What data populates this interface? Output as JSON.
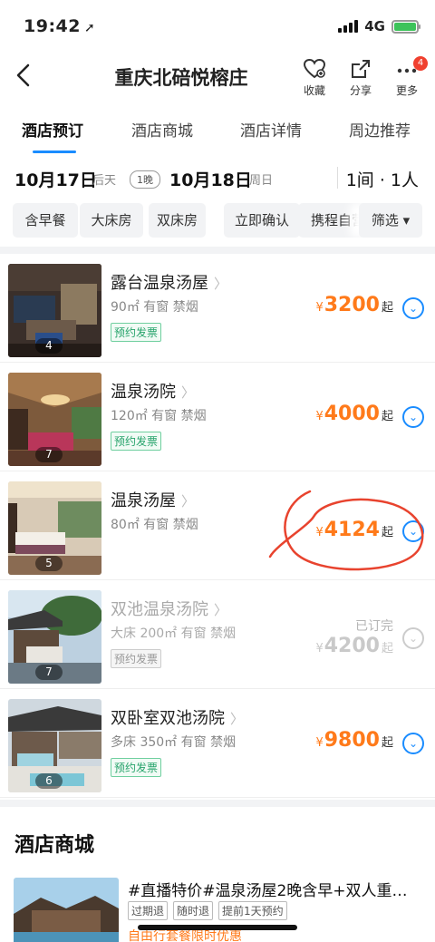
{
  "status": {
    "time": "19:42",
    "network": "4G"
  },
  "nav": {
    "title": "重庆北碚悦榕庄",
    "actions": [
      {
        "label": "收藏",
        "icon": "heart-icon"
      },
      {
        "label": "分享",
        "icon": "share-icon"
      },
      {
        "label": "更多",
        "icon": "more-icon",
        "badge": "4"
      }
    ]
  },
  "tabs": [
    "酒店预订",
    "酒店商城",
    "酒店详情",
    "周边推荐"
  ],
  "dates": {
    "checkin": "10月17日",
    "checkin_day": "后天",
    "nights": "1晚",
    "checkout": "10月18日",
    "checkout_day": "周日",
    "rooms_guests": "1间 · 1人"
  },
  "filters": [
    "含早餐",
    "大床房",
    "双床房",
    "立即确认",
    "携程自营"
  ],
  "filter_button": "筛选 ▾",
  "rooms": [
    {
      "name": "露台温泉汤屋",
      "info": "90㎡  有窗  禁烟",
      "invoice": "预约发票",
      "price": "3200",
      "photos": "4",
      "sold_out": false
    },
    {
      "name": "温泉汤院",
      "info": "120㎡  有窗  禁烟",
      "invoice": "预约发票",
      "price": "4000",
      "photos": "7",
      "sold_out": false
    },
    {
      "name": "温泉汤屋",
      "info": "80㎡  有窗  禁烟",
      "invoice": "",
      "price": "4124",
      "photos": "5",
      "sold_out": false
    },
    {
      "name": "双池温泉汤院",
      "info": "大床 200㎡  有窗  禁烟",
      "invoice": "预约发票",
      "price": "4200",
      "photos": "7",
      "sold_out": true,
      "sold_label": "已订完"
    },
    {
      "name": "双卧室双池汤院",
      "info": "多床 350㎡  有窗  禁烟",
      "invoice": "预约发票",
      "price": "9800",
      "photos": "6",
      "sold_out": false
    }
  ],
  "price_prefix": "¥",
  "price_suffix": "起",
  "mall": {
    "title": "酒店商城",
    "item_name": "#直播特价#温泉汤屋2晚含早+双人重…",
    "tags": [
      "过期退",
      "随时退",
      "提前1天预约"
    ],
    "promo": "自由行套餐限时优惠"
  },
  "colors": {
    "accent": "#1a8cff",
    "price": "#ff7a1a",
    "badge": "#f0402f",
    "annotation": "#e8432e"
  }
}
